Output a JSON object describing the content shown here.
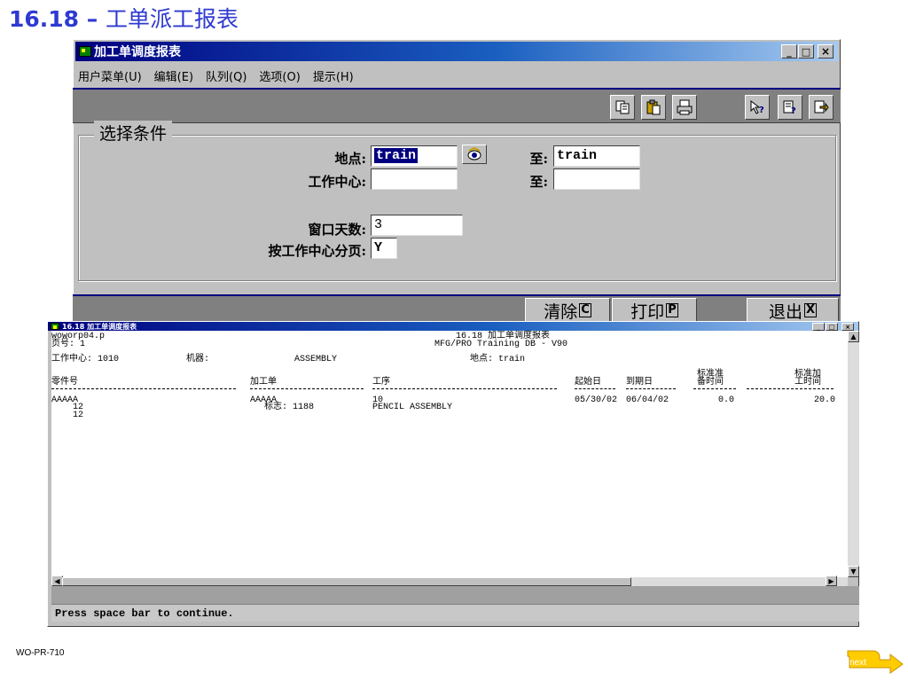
{
  "slide": {
    "title_number": "16.18 –",
    "title_text": "工单派工报表",
    "footer_code": "WO-PR-710",
    "next_label": "next"
  },
  "main_window": {
    "title": "加工单调度报表",
    "controls": {
      "minimize": "_",
      "maximize": "□",
      "close": "×"
    },
    "menu": [
      "用户菜单(U)",
      "编辑(E)",
      "队列(Q)",
      "选项(O)",
      "提示(H)"
    ],
    "toolbar_icons": [
      "copy-icon",
      "paste-icon",
      "print-icon",
      "help-query-icon",
      "help-field-icon",
      "exit-icon"
    ],
    "group_title": "选择条件",
    "fields": {
      "site_label": "地点:",
      "site_value": "train",
      "site_to_label": "至:",
      "site_to_value": "train",
      "wc_label": "工作中心:",
      "wc_value": "",
      "wc_to_label": "至:",
      "wc_to_value": "",
      "window_days_label": "窗口天数:",
      "window_days_value": "3",
      "page_by_wc_label": "按工作中心分页:",
      "page_by_wc_value": "Y"
    },
    "buttons": {
      "clear": "清除",
      "clear_key": "C",
      "print": "打印",
      "print_key": "P",
      "exit": "退出",
      "exit_key": "X"
    }
  },
  "report_window": {
    "title": "16.18 加工单调度报表",
    "controls": {
      "minimize": "_",
      "maximize": "□",
      "close": "×"
    },
    "header": {
      "program": "woworp04.p",
      "page_label": "页号: 1",
      "report_title": "16.18 加工单调度报表",
      "db_line": "MFG/PRO Training DB - V90",
      "wc_line": "工作中心: 1010",
      "machine_label": "机器:",
      "wc_desc": "ASSEMBLY",
      "site_line": "地点: train"
    },
    "columns": {
      "part": "零件号",
      "wo": "加工单",
      "op": "工序",
      "start": "起始日",
      "due": "到期日",
      "setup_l1": "标准准",
      "setup_l2": "备时间",
      "run_l1": "标准加",
      "run_l2": "工时间"
    },
    "rows": [
      {
        "part": "AAAAA",
        "part_l2": "12",
        "part_l3": "12",
        "wo": "AAAAA",
        "wo_l2": "标志: 1188",
        "op": "10",
        "op_desc": "PENCIL ASSEMBLY",
        "start": "05/30/02",
        "due": "06/04/02",
        "setup": "0.0",
        "run": "20.0"
      }
    ],
    "prompt": "Press space bar to continue."
  }
}
